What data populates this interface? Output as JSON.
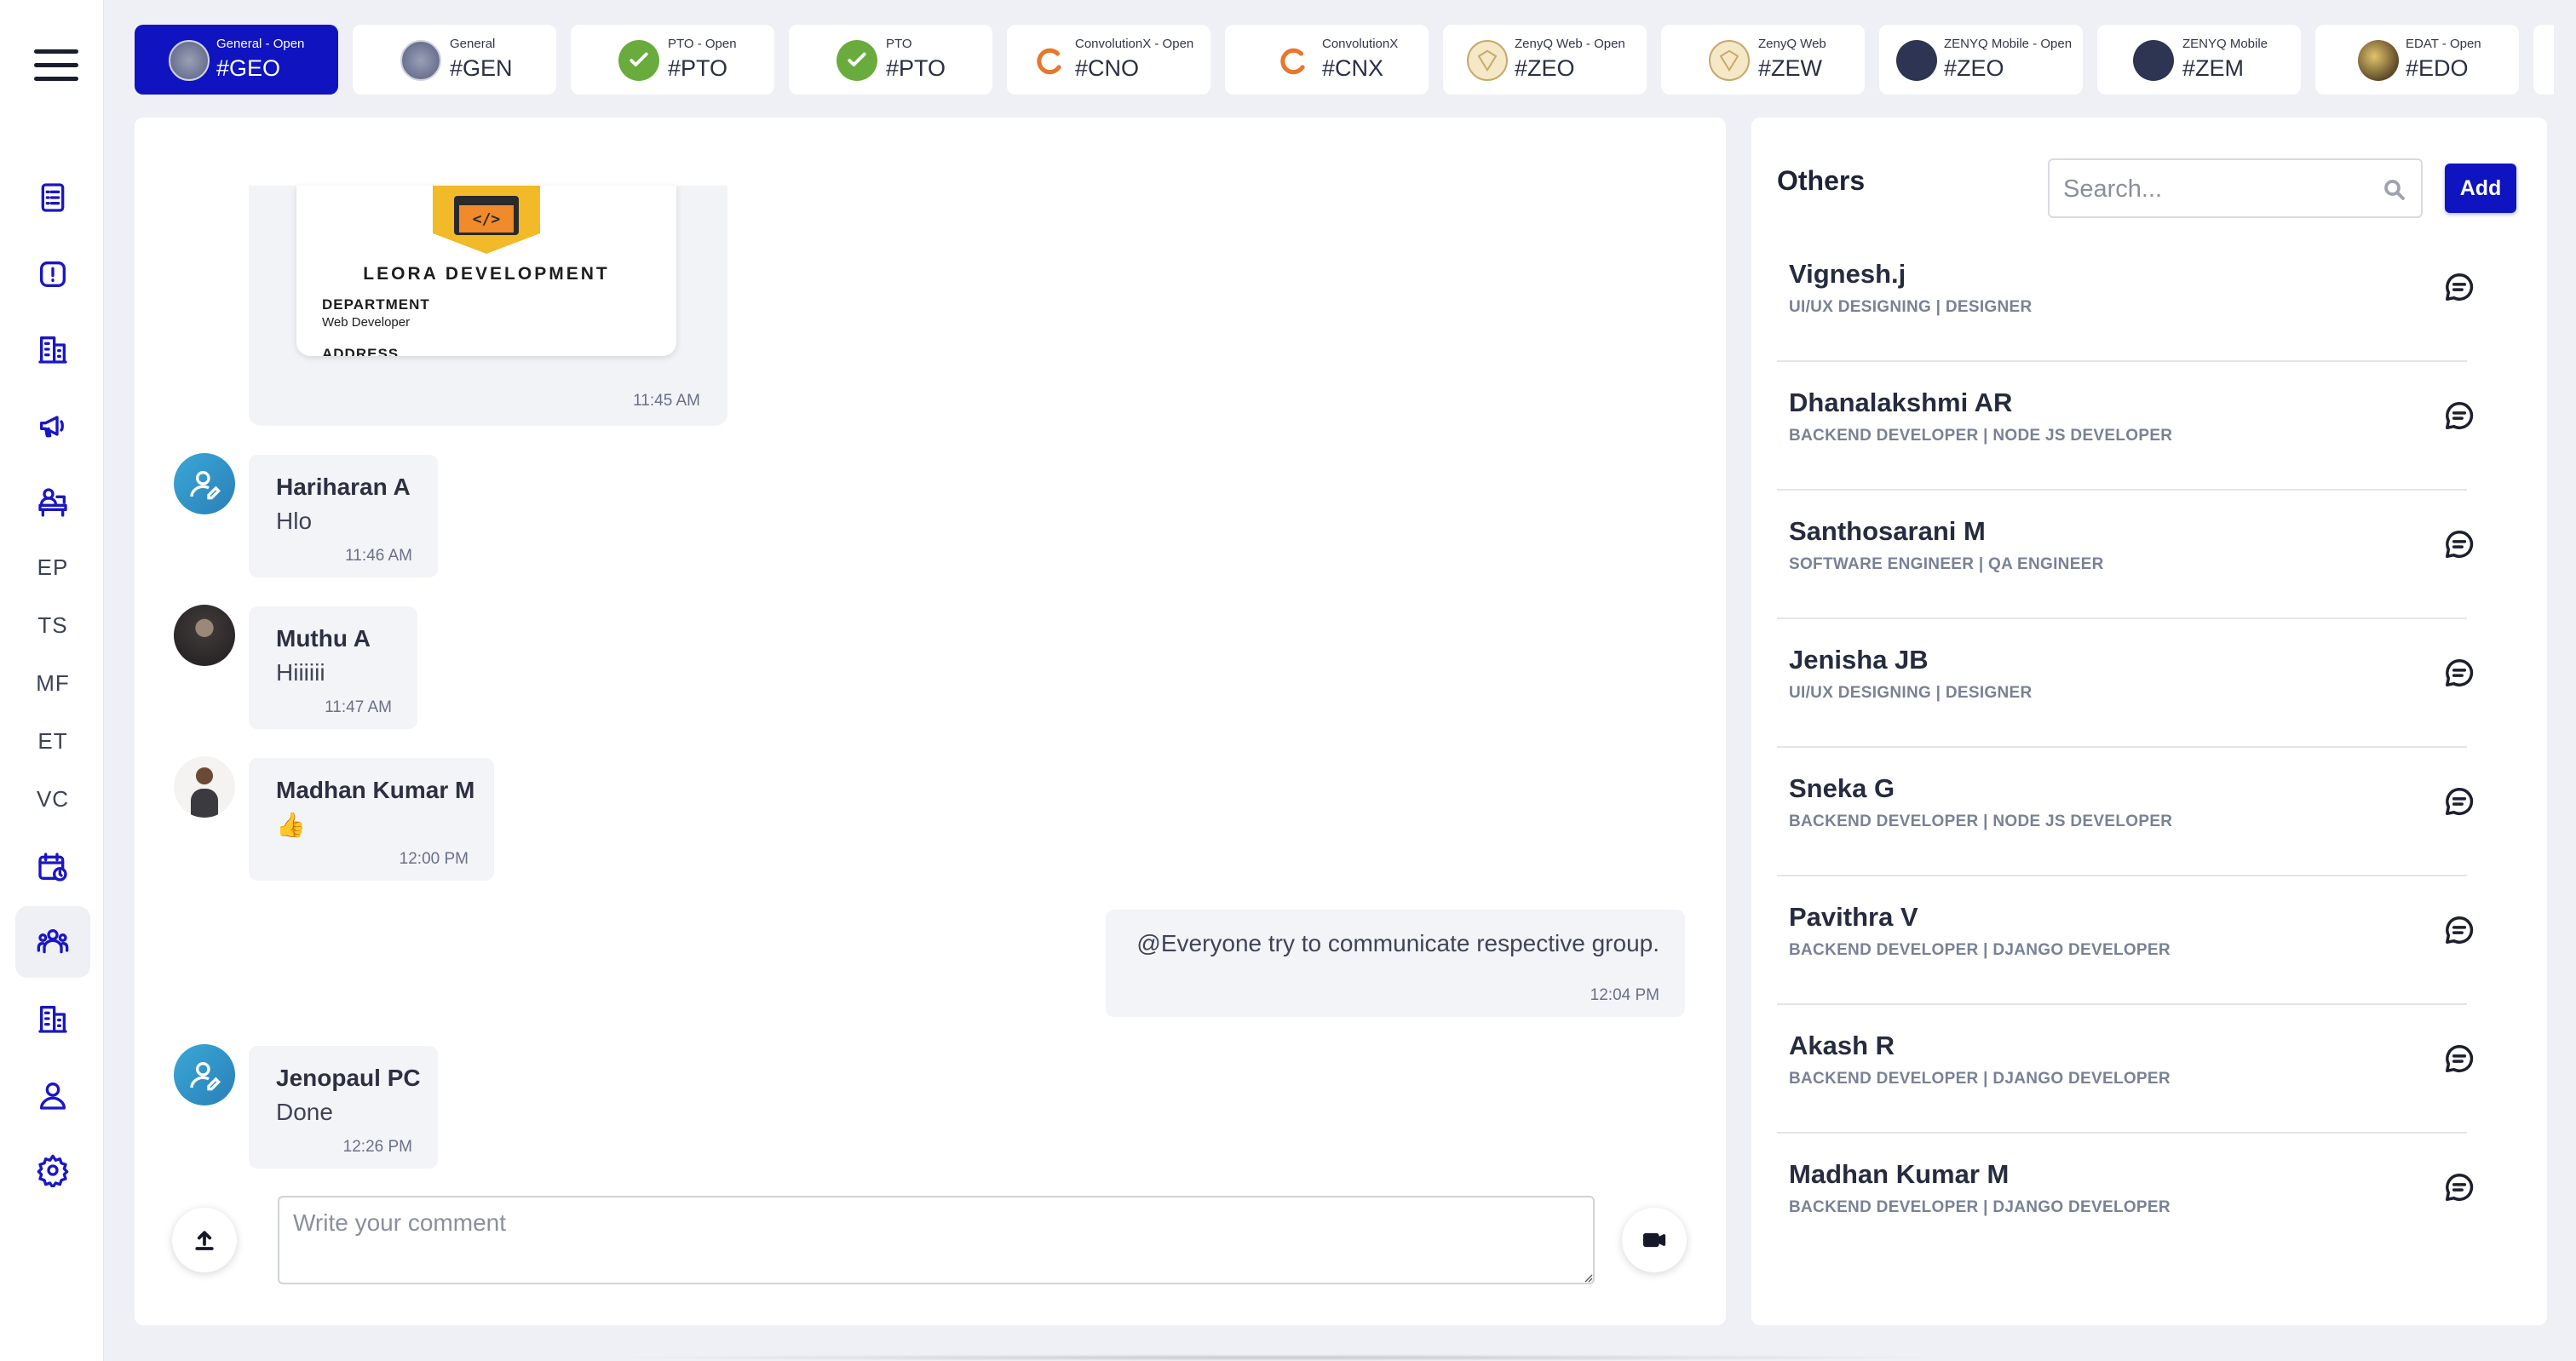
{
  "rail": {
    "text_items": [
      "EP",
      "TS",
      "MF",
      "ET",
      "VC"
    ]
  },
  "tabs": [
    {
      "top": "General - Open",
      "code": "#GEO",
      "icon": "general-logo",
      "active": true
    },
    {
      "top": "General",
      "code": "#GEN",
      "icon": "general-logo",
      "active": false
    },
    {
      "top": "PTO - Open",
      "code": "#PTO",
      "icon": "check-circle",
      "active": false
    },
    {
      "top": "PTO",
      "code": "#PTO",
      "icon": "check-circle",
      "active": false
    },
    {
      "top": "ConvolutionX - Open",
      "code": "#CNO",
      "icon": "convolution-logo",
      "active": false
    },
    {
      "top": "ConvolutionX",
      "code": "#CNX",
      "icon": "convolution-logo",
      "active": false
    },
    {
      "top": "ZenyQ Web - Open",
      "code": "#ZEO",
      "icon": "zenyq-web-logo",
      "active": false
    },
    {
      "top": "ZenyQ Web",
      "code": "#ZEW",
      "icon": "zenyq-web-logo",
      "active": false
    },
    {
      "top": "ZENYQ Mobile - Open",
      "code": "#ZEO",
      "icon": "zenyq-mobile-logo",
      "active": false
    },
    {
      "top": "ZENYQ Mobile",
      "code": "#ZEM",
      "icon": "zenyq-mobile-logo",
      "active": false
    },
    {
      "top": "EDAT - Open",
      "code": "#EDO",
      "icon": "edat-logo",
      "active": false
    }
  ],
  "chat": {
    "image_message": {
      "card_title": "LEORA DEVELOPMENT",
      "department_label": "DEPARTMENT",
      "department_value": "Web Developer",
      "address_label": "ADDRESS",
      "time": "11:45 AM"
    },
    "messages": [
      {
        "name": "Hariharan A",
        "text": "Hlo",
        "time": "11:46 AM"
      },
      {
        "name": "Muthu A",
        "text": "Hiiiiii",
        "time": "11:47 AM"
      },
      {
        "name": "Madhan Kumar M",
        "text": "👍",
        "time": "12:00 PM"
      },
      {
        "name": "",
        "text": "@Everyone try to communicate respective group.",
        "time": "12:04 PM"
      },
      {
        "name": "Jenopaul PC",
        "text": "Done",
        "time": "12:26 PM"
      }
    ],
    "composer_placeholder": "Write your comment"
  },
  "others": {
    "title": "Others",
    "search_placeholder": "Search...",
    "add_label": "Add",
    "contacts": [
      {
        "name": "Vignesh.j",
        "role": "UI/UX DESIGNING | DESIGNER"
      },
      {
        "name": "Dhanalakshmi AR",
        "role": "BACKEND DEVELOPER | NODE JS DEVELOPER"
      },
      {
        "name": "Santhosarani M",
        "role": "SOFTWARE ENGINEER | QA ENGINEER"
      },
      {
        "name": "Jenisha JB",
        "role": "UI/UX DESIGNING | DESIGNER"
      },
      {
        "name": "Sneka G",
        "role": "BACKEND DEVELOPER | NODE JS DEVELOPER"
      },
      {
        "name": "Pavithra V",
        "role": "BACKEND DEVELOPER | DJANGO DEVELOPER"
      },
      {
        "name": "Akash R",
        "role": "BACKEND DEVELOPER | DJANGO DEVELOPER"
      },
      {
        "name": "Madhan Kumar M",
        "role": "BACKEND DEVELOPER | DJANGO DEVELOPER"
      }
    ]
  },
  "colors": {
    "accent": "#0f14c0",
    "icon_blue": "#1a16c4",
    "page_bg": "#eef0f5"
  }
}
